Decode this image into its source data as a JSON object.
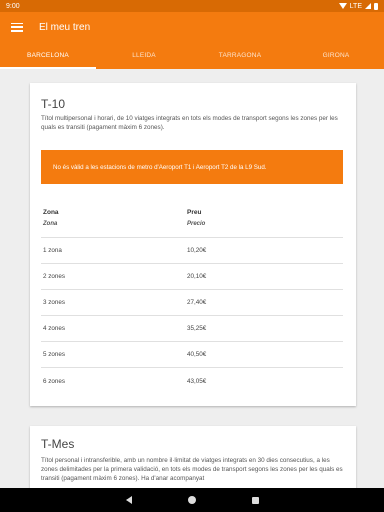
{
  "status_bar": {
    "time": "9:00",
    "network": "LTE"
  },
  "app": {
    "title": "El meu tren",
    "menu_icon": "hamburger-menu-icon"
  },
  "tabs": [
    {
      "label": "BARCELONA",
      "active": true
    },
    {
      "label": "LLEIDA",
      "active": false
    },
    {
      "label": "TARRAGONA",
      "active": false
    },
    {
      "label": "GIRONA",
      "active": false
    }
  ],
  "t10": {
    "title": "T-10",
    "description": "Títol multipersonal i horari, de 10 viatges integrats en tots els modes de transport segons les zones per les quals es transiti (pagament màxim 6 zones).",
    "warning": "No és vàlid a les estacions de metro d'Aeroport T1 i Aeroport T2 de la L9 Sud.",
    "table": {
      "col_zone": "Zona",
      "col_zone_sub": "Zona",
      "col_price": "Preu",
      "col_price_sub": "Precio",
      "rows": [
        {
          "zone": "1 zona",
          "price": "10,20€"
        },
        {
          "zone": "2 zones",
          "price": "20,10€"
        },
        {
          "zone": "3 zones",
          "price": "27,40€"
        },
        {
          "zone": "4 zones",
          "price": "35,25€"
        },
        {
          "zone": "5 zones",
          "price": "40,50€"
        },
        {
          "zone": "6 zones",
          "price": "43,05€"
        }
      ]
    }
  },
  "tmes": {
    "title": "T-Mes",
    "description": "Títol personal i intransferible, amb un nombre il·limitat de viatges integrats en 30 dies consecutius, a les zones delimitades per la primera validació, en tots els modes de transport segons les zones per les quals es transiti (pagament màxim 6 zones). Ha d'anar acompanyat"
  },
  "nav": {
    "back": "back-icon",
    "home": "home-icon",
    "recents": "recents-icon"
  }
}
